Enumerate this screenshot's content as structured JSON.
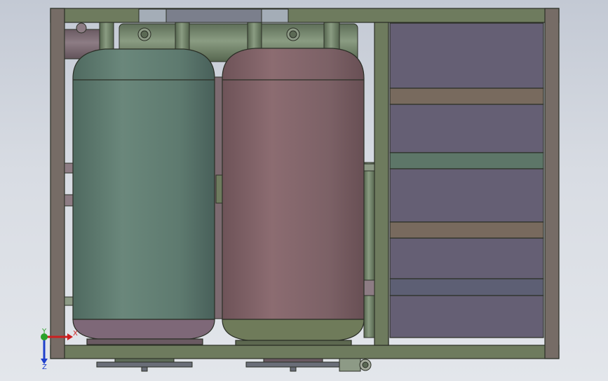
{
  "viewport": {
    "background_top": "#c3c9d4",
    "background_bottom": "#e3e6eb"
  },
  "model": {
    "frame_color": "#6e7b5e",
    "frame_edge": "#2b2f26",
    "tank_left_color": "#5f7b70",
    "tank_right_color": "#806266",
    "tank_left_bottom_color": "#7e6878",
    "tank_right_bottom_color": "#6f7b5a",
    "panel_color": "#655f74",
    "divider_band_color": "#786a5e",
    "divider_band_alt_color": "#5d7668",
    "pipe_green": "#6f836a",
    "pipe_mauve": "#7a6a72"
  },
  "triad": {
    "x_label": "X",
    "y_label": "Y",
    "z_label": "Z",
    "x_color": "#cc1f1f",
    "y_color": "#2aa12a",
    "z_color": "#1f3fcc"
  }
}
